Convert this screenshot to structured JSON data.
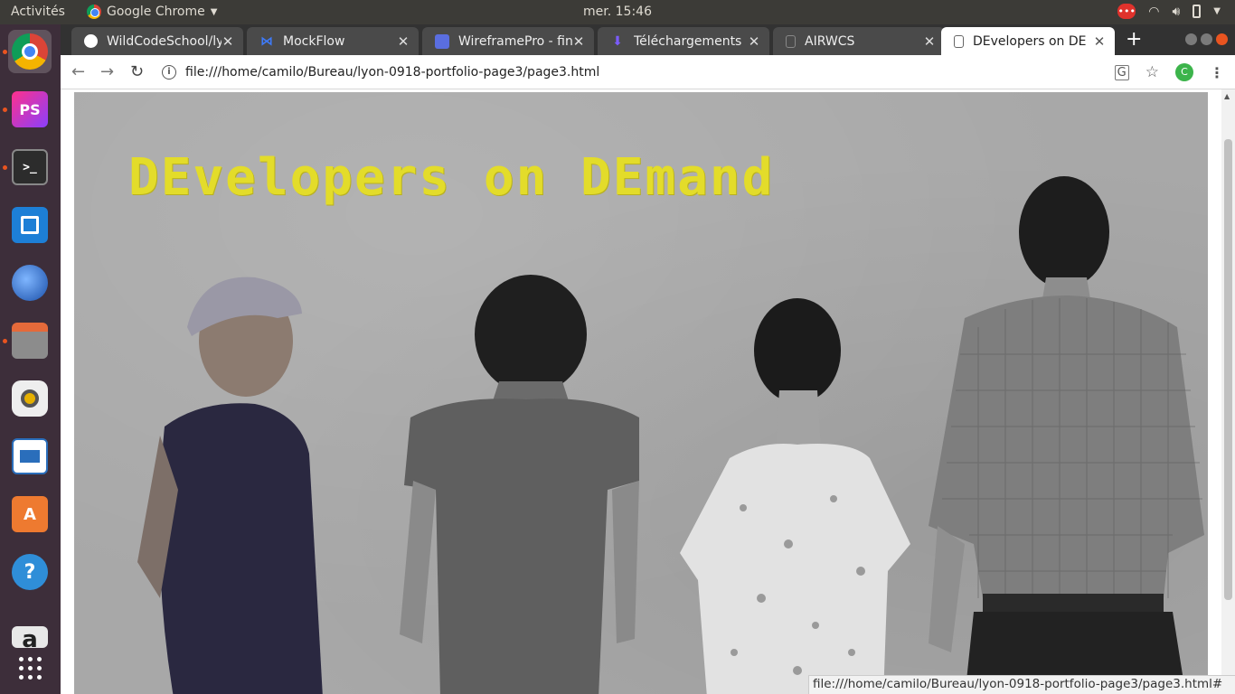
{
  "topbar": {
    "activities": "Activités",
    "app_name": "Google Chrome",
    "clock": "mer. 15:46"
  },
  "tabs": [
    {
      "label": "WildCodeSchool/ly",
      "icon": "github-icon"
    },
    {
      "label": "MockFlow",
      "icon": "mockflow-icon"
    },
    {
      "label": "WireframePro - fin",
      "icon": "wireframepro-icon"
    },
    {
      "label": "Téléchargements",
      "icon": "download-icon"
    },
    {
      "label": "AIRWCS",
      "icon": "document-icon"
    },
    {
      "label": "DEvelopers on DE",
      "icon": "document-icon"
    }
  ],
  "toolbar": {
    "url": "file:///home/camilo/Bureau/lyon-0918-portfolio-page3/page3.html",
    "profile_initial": "C"
  },
  "page": {
    "hero_title": "DEvelopers on DEmand"
  },
  "status_bar": {
    "url": "file:///home/camilo/Bureau/lyon-0918-portfolio-page3/page3.html#"
  },
  "launcher": [
    {
      "name": "chrome-icon"
    },
    {
      "name": "phpstorm-icon",
      "text": "PS"
    },
    {
      "name": "terminal-icon",
      "text": ">_"
    },
    {
      "name": "brackets-icon"
    },
    {
      "name": "thunderbird-icon"
    },
    {
      "name": "files-icon"
    },
    {
      "name": "rhythmbox-icon"
    },
    {
      "name": "libreoffice-writer-icon"
    },
    {
      "name": "software-center-icon",
      "text": "A"
    },
    {
      "name": "help-icon",
      "text": "?"
    },
    {
      "name": "amazon-icon",
      "text": "a"
    },
    {
      "name": "show-apps-icon"
    }
  ]
}
